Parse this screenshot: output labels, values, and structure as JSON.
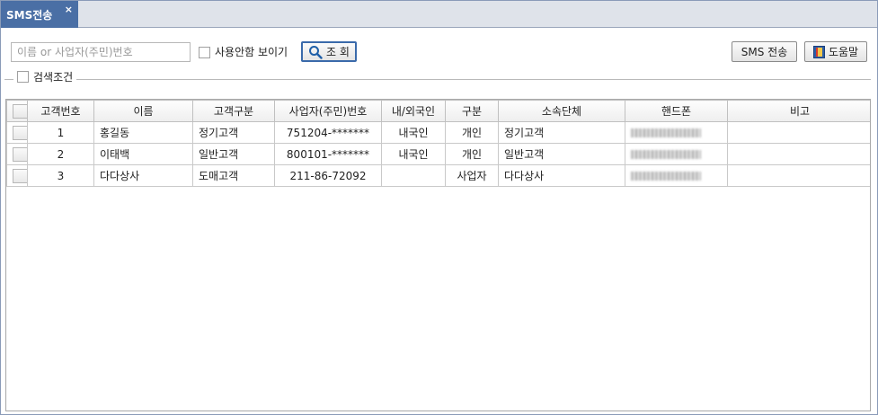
{
  "tab": {
    "title": "SMS전송",
    "close": "×"
  },
  "toolbar": {
    "search_placeholder": "이름 or 사업자(주민)번호",
    "show_unused_label": "사용안함 보이기",
    "search_button_label": "조 회",
    "sms_button_label": "SMS 전송",
    "help_button_label": "도움말"
  },
  "search_condition": {
    "label": "검색조건"
  },
  "table": {
    "columns": [
      "고객번호",
      "이름",
      "고객구분",
      "사업자(주민)번호",
      "내/외국인",
      "구분",
      "소속단체",
      "핸드폰",
      "비고"
    ],
    "rows": [
      {
        "no": "1",
        "name": "홍길동",
        "type": "정기고객",
        "reg": "751204-*******",
        "nation": "내국인",
        "kind": "개인",
        "group": "정기고객",
        "memo": ""
      },
      {
        "no": "2",
        "name": "이태백",
        "type": "일반고객",
        "reg": "800101-*******",
        "nation": "내국인",
        "kind": "개인",
        "group": "일반고객",
        "memo": ""
      },
      {
        "no": "3",
        "name": "다다상사",
        "type": "도매고객",
        "reg": "211-86-72092",
        "nation": "",
        "kind": "사업자",
        "group": "다다상사",
        "memo": ""
      }
    ]
  },
  "colors": {
    "tab_bg": "#4a6fa5",
    "accent": "#3a6aaa"
  }
}
